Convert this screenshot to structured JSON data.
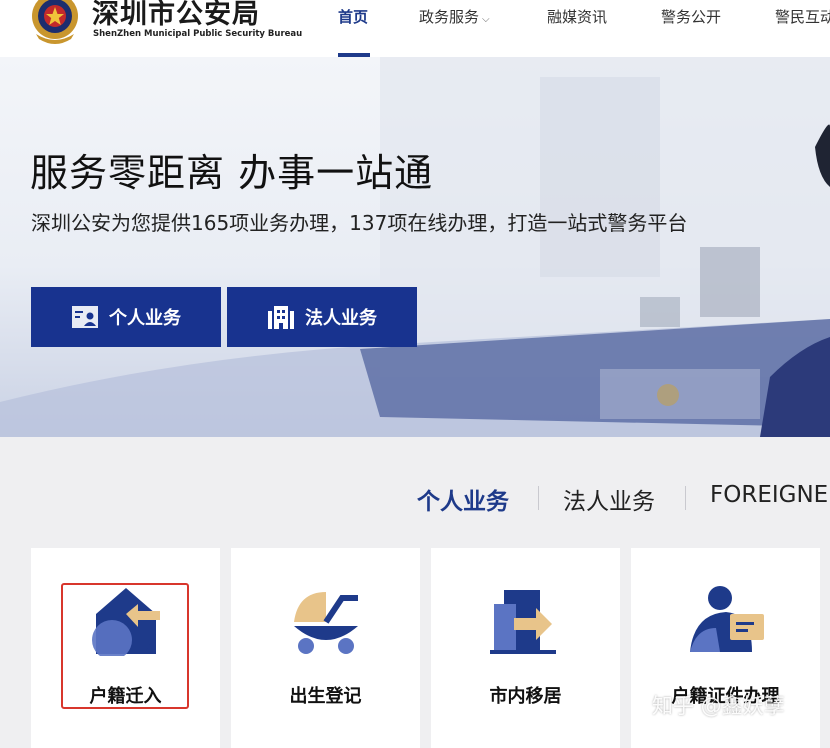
{
  "header": {
    "title": "深圳市公安局",
    "subtitle": "ShenZhen Municipal Public Security Bureau",
    "nav": [
      {
        "label": "首页",
        "active": true
      },
      {
        "label": "政务服务",
        "has_dropdown": true
      },
      {
        "label": "融媒资讯"
      },
      {
        "label": "警务公开"
      },
      {
        "label": "警民互动"
      }
    ]
  },
  "hero": {
    "title": "服务零距离 办事一站通",
    "subtitle": "深圳公安为您提供165项业务办理，137项在线办理，打造一站式警务平台",
    "buttons": [
      {
        "label": "个人业务",
        "icon": "id-card-icon"
      },
      {
        "label": "法人业务",
        "icon": "building-icon"
      }
    ]
  },
  "tabs": [
    {
      "label": "个人业务",
      "active": true
    },
    {
      "label": "法人业务"
    },
    {
      "label": "FOREIGNER"
    }
  ],
  "cards": [
    {
      "label": "户籍迁入",
      "icon": "house-move-in-icon",
      "highlighted": true
    },
    {
      "label": "出生登记",
      "icon": "baby-stroller-icon"
    },
    {
      "label": "市内移居",
      "icon": "building-arrow-icon"
    },
    {
      "label": "户籍证件办理",
      "icon": "person-id-card-icon"
    }
  ],
  "watermark": "知乎 @鑫妖孽",
  "colors": {
    "primary": "#18338f",
    "accent": "#e8c48a",
    "highlight": "#d8362c"
  }
}
